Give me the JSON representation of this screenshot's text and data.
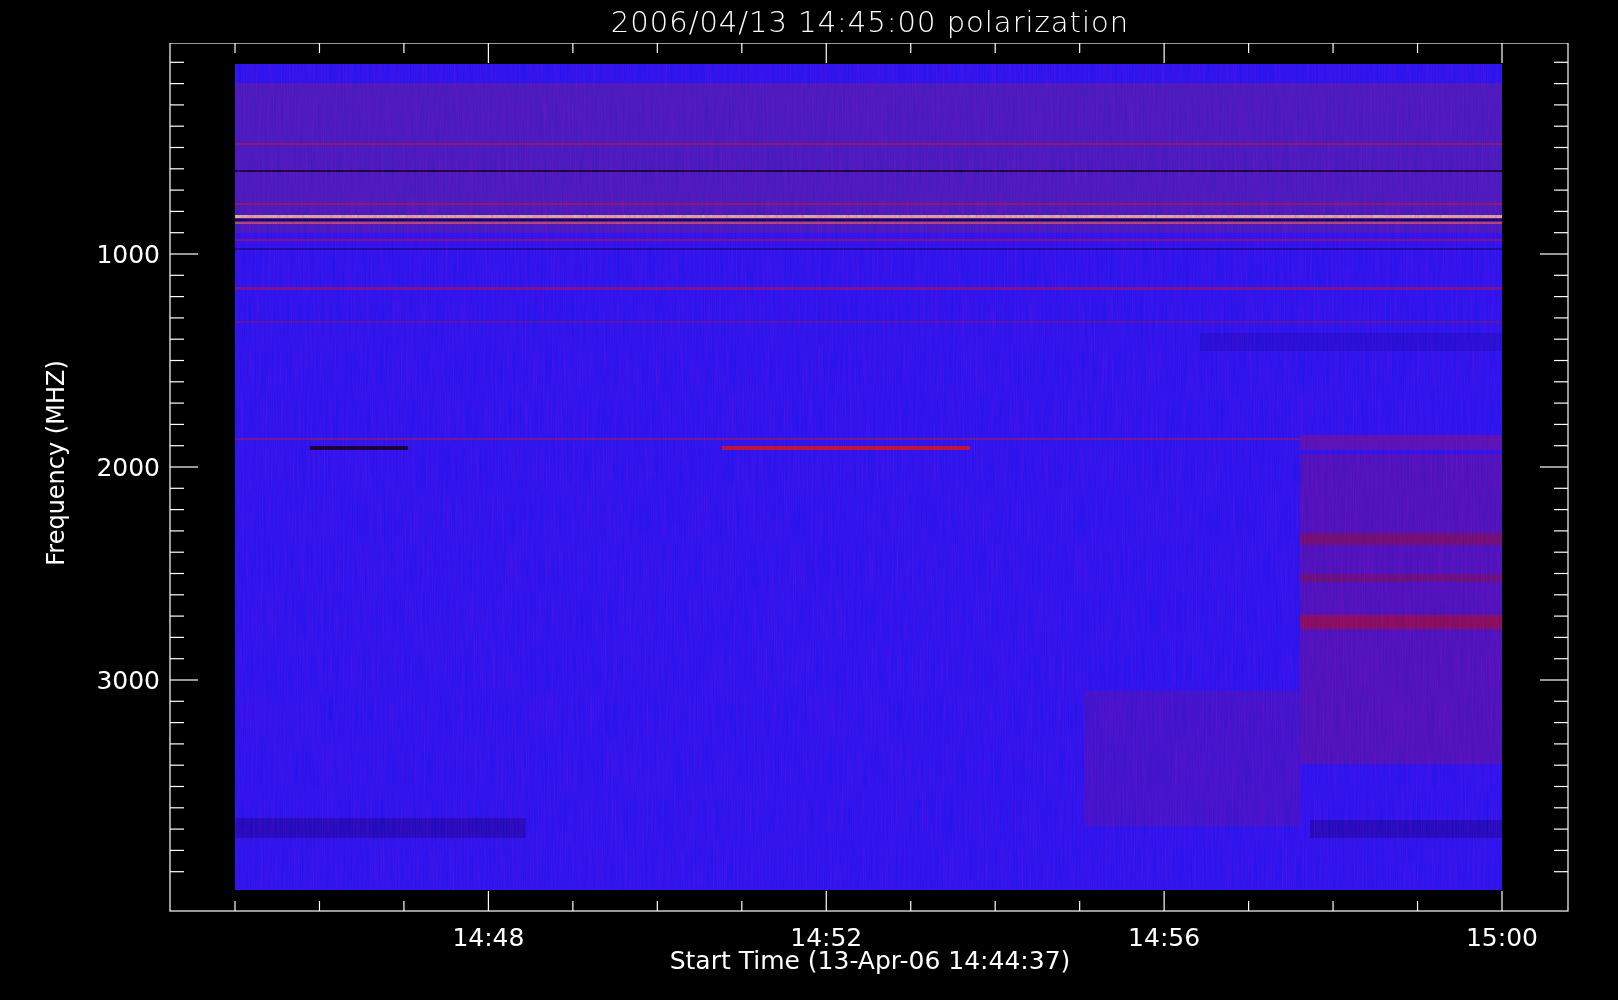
{
  "title": "2006/04/13 14:45:00 polarization",
  "y_axis": {
    "label": "Frequency (MHZ)",
    "tick_labels": [
      "1000",
      "2000",
      "3000"
    ]
  },
  "x_axis": {
    "label": "Start Time (13-Apr-06 14:44:37)",
    "tick_labels": [
      "14:48",
      "14:52",
      "14:56",
      "15:00"
    ]
  }
}
